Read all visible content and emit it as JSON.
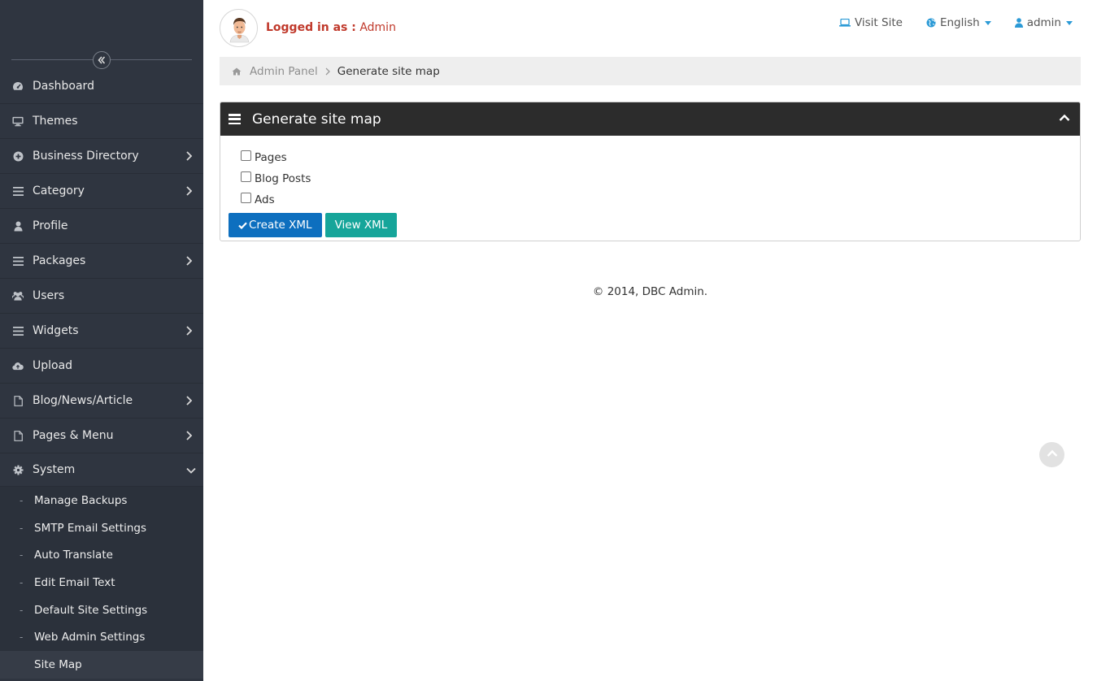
{
  "sidebar": {
    "collapse_icon": "double-chevron-left-icon",
    "items": [
      {
        "label": "Dashboard",
        "icon": "dashboard-icon",
        "has_children": false
      },
      {
        "label": "Themes",
        "icon": "desktop-icon",
        "has_children": false
      },
      {
        "label": "Business Directory",
        "icon": "plus-circle-icon",
        "has_children": true
      },
      {
        "label": "Category",
        "icon": "list-icon",
        "has_children": true
      },
      {
        "label": "Profile",
        "icon": "user-icon",
        "has_children": false
      },
      {
        "label": "Packages",
        "icon": "list-icon",
        "has_children": true
      },
      {
        "label": "Users",
        "icon": "users-icon",
        "has_children": false
      },
      {
        "label": "Widgets",
        "icon": "list-icon",
        "has_children": true
      },
      {
        "label": "Upload",
        "icon": "cloud-upload-icon",
        "has_children": false
      },
      {
        "label": "Blog/News/Article",
        "icon": "file-icon",
        "has_children": true
      },
      {
        "label": "Pages & Menu",
        "icon": "file-icon",
        "has_children": true
      },
      {
        "label": "System",
        "icon": "gear-icon",
        "has_children": true,
        "expanded": true
      }
    ],
    "system_children": [
      {
        "label": "Manage Backups"
      },
      {
        "label": "SMTP Email Settings"
      },
      {
        "label": "Auto Translate"
      },
      {
        "label": "Edit Email Text"
      },
      {
        "label": "Default Site Settings"
      },
      {
        "label": "Web Admin Settings"
      },
      {
        "label": "Site Map",
        "active": true
      }
    ]
  },
  "header": {
    "logged_in_label": "Logged in as :",
    "username": "Admin",
    "visit_site": "Visit Site",
    "language": "English",
    "user_menu": "admin"
  },
  "breadcrumb": {
    "root": "Admin Panel",
    "current": "Generate site map"
  },
  "panel": {
    "title": "Generate site map",
    "options": [
      {
        "label": "Pages",
        "checked": false
      },
      {
        "label": "Blog Posts",
        "checked": false
      },
      {
        "label": "Ads",
        "checked": false
      }
    ],
    "create_button": "Create XML",
    "view_button": "View XML"
  },
  "footer": {
    "text": "© 2014, DBC Admin."
  },
  "colors": {
    "sidebar_bg": "#2f3540",
    "accent_red": "#c0392b",
    "accent_blue": "#2b9ad6",
    "primary_button": "#0d6fbf",
    "teal_button": "#16a59a",
    "panel_header": "#2c2c2c"
  }
}
